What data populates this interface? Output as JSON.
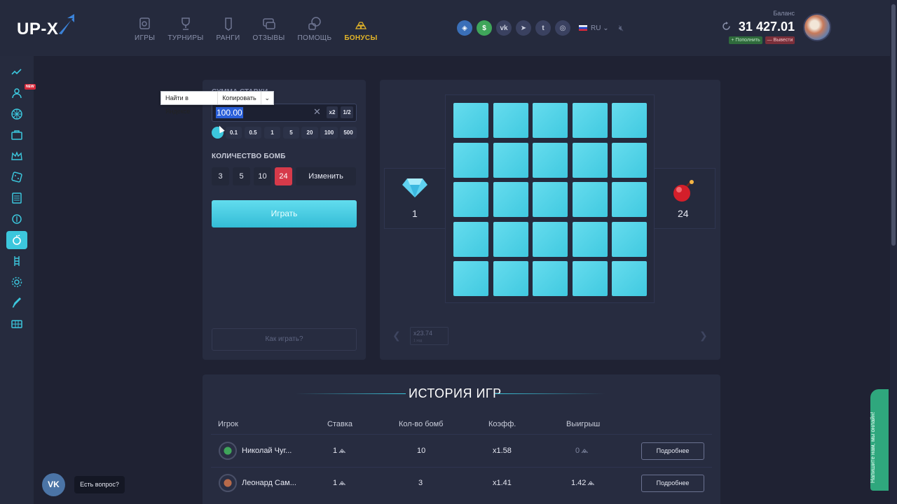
{
  "brand": {
    "logo_text": "UP-X",
    "accent": "#3cc7dd",
    "bonus_color": "#e3b528",
    "danger": "#d63a4a"
  },
  "nav": {
    "items": [
      {
        "label": "ИГРЫ",
        "icon": "games-icon"
      },
      {
        "label": "ТУРНИРЫ",
        "icon": "trophy-icon"
      },
      {
        "label": "РАНГИ",
        "icon": "rank-icon"
      },
      {
        "label": "ОТЗЫВЫ",
        "icon": "reviews-icon"
      },
      {
        "label": "ПОМОЩЬ",
        "icon": "help-icon"
      },
      {
        "label": "БОНУСЫ",
        "icon": "gold-bars-icon",
        "active": true
      }
    ]
  },
  "header": {
    "socials": [
      "shield-badge-icon",
      "dollar-icon",
      "vk-icon",
      "telegram-icon",
      "twitter-icon",
      "instagram-icon"
    ],
    "lang": "RU",
    "balance_label": "Баланс",
    "balance_value": "31 427.01",
    "deposit_label": "+ Пополнить",
    "withdraw_label": "— Вывести"
  },
  "sidebar": {
    "items": [
      "trend-icon",
      "user-new-icon",
      "wheel-icon",
      "case-icon",
      "crown-icon",
      "dice-icon",
      "slot-icon",
      "coin-flip-icon",
      "mines-icon",
      "ladder-icon",
      "gear-icon",
      "rocket-icon",
      "keno-icon"
    ],
    "active_index": 8,
    "new_badge": "NEW"
  },
  "bet": {
    "label": "СУММА СТАВКИ",
    "value": "100.00",
    "x2": "x2",
    "half": "1/2",
    "quick": [
      "0.1",
      "0.5",
      "1",
      "5",
      "20",
      "100",
      "500"
    ]
  },
  "context_menu": {
    "find": "Найти в Яндексе",
    "copy": "Копировать"
  },
  "bombs": {
    "label": "КОЛИЧЕСТВО БОМБ",
    "options": [
      "3",
      "5",
      "10",
      "24"
    ],
    "selected": "24",
    "change": "Изменить"
  },
  "play_label": "Играть",
  "howto_label": "Как играть?",
  "board": {
    "gems": "1",
    "bombs": "24",
    "multiplier": "x23.74",
    "multiplier_sub": "1 ход"
  },
  "history": {
    "title": "ИСТОРИЯ ИГР",
    "columns": [
      "Игрок",
      "Ставка",
      "Кол-во бомб",
      "Коэфф.",
      "Выигрыш"
    ],
    "rows": [
      {
        "player": "Николай Чуг...",
        "bet": "1",
        "bombs": "10",
        "coef": "x1.58",
        "win": "0",
        "details": "Подробнее"
      },
      {
        "player": "Леонард Сам...",
        "bet": "1",
        "bombs": "3",
        "coef": "x1.41",
        "win": "1.42",
        "details": "Подробнее"
      }
    ]
  },
  "vk_widget": {
    "label": "VK",
    "bubble": "Есть вопрос?"
  },
  "chat": {
    "text": "Напишите нам, мы онлайн!"
  }
}
